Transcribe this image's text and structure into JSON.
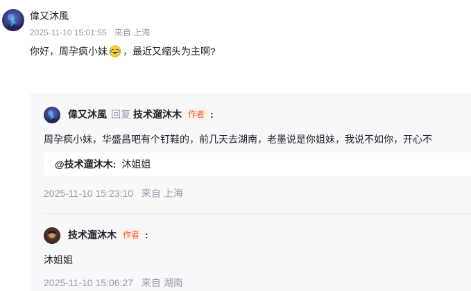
{
  "comment": {
    "username": "偉又沐風",
    "time": "2025-11-10 15:01:55",
    "location": "来自 上海",
    "text_before_emoji": "你好，周孕疯小妹",
    "emoji": "laughing-crying-emoji",
    "text_after_emoji": "，最近又缩头为主啊?"
  },
  "replies": [
    {
      "username": "偉又沐風",
      "verb": "回复",
      "target": "技术遛沐木",
      "author_tag": "作者",
      "colon": ":",
      "text": "周孕疯小妹，华盛昌吧有个钉鞋的，前几天去湖南，老墨说是你姐妹，我说不如你，开心不",
      "quote": {
        "name": "@技术遛沐木:",
        "text": "沐姐姐"
      },
      "time": "2025-11-10 15:23:10",
      "location": "来自 上海"
    },
    {
      "username": "技术遛沐木",
      "author_tag": "作者",
      "colon": ":",
      "text": "沐姐姐",
      "time": "2025-11-10 15:06:27",
      "location": "来自 湖南"
    }
  ],
  "colors": {
    "author_tag": "#fc5531",
    "meta": "#999aaa",
    "reply_bg": "#f7f8fa"
  }
}
